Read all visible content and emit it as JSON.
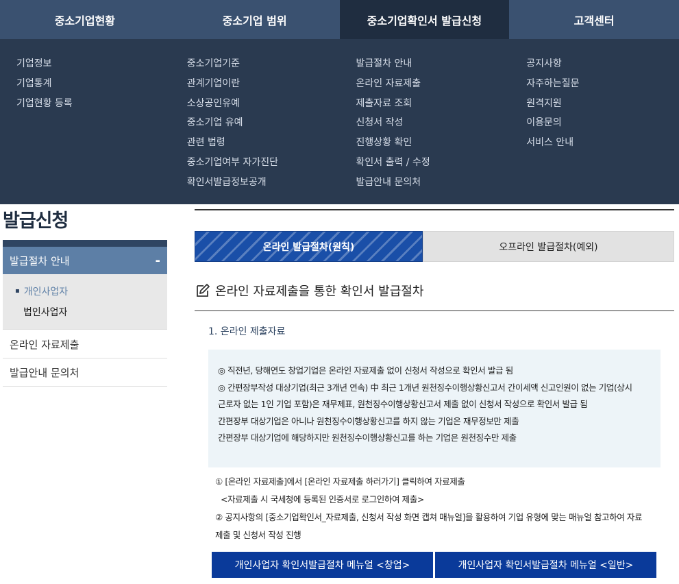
{
  "topnav": {
    "items": [
      {
        "label": "중소기업현황"
      },
      {
        "label": "중소기업 범위"
      },
      {
        "label": "중소기업확인서 발급신청"
      },
      {
        "label": "고객센터"
      }
    ]
  },
  "mega": {
    "col1": [
      "기업정보",
      "기업통계",
      "기업현황 등록"
    ],
    "col2": [
      "중소기업기준",
      "관계기업이란",
      "소상공인유예",
      "중소기업 유예",
      "관련 법령",
      "중소기업여부 자가진단",
      "확인서발급정보공개"
    ],
    "col3": [
      "발급절차 안내",
      "온라인 자료제출",
      "제출자료 조회",
      "신청서 작성",
      "진행상황 확인",
      "확인서 출력 / 수정",
      "발급안내 문의처"
    ],
    "col4": [
      "공지사항",
      "자주하는질문",
      "원격지원",
      "이용문의",
      "서비스 안내"
    ]
  },
  "sidebar": {
    "heading": "발급신청",
    "active_label": "발급절차 안내",
    "collapse_symbol": "-",
    "sub_items": [
      "개인사업자",
      "법인사업자"
    ],
    "items": [
      "온라인 자료제출",
      "발급안내 문의처"
    ]
  },
  "main": {
    "tabs": [
      "온라인 발급절차(원칙)",
      "오프라인 발급절차(예외)"
    ],
    "section_title": "온라인 자료제출을 통한 확인서 발급절차",
    "sub_head": "1. 온라인 제출자료",
    "info_lines": [
      "◎ 직전년, 당해연도 창업기업은 온라인 자료제출 없이 신청서 작성으로 확인서 발급 됨",
      "◎ 간편장부작성 대상기업(최근 3개년 연속) 中 최근 1개년 원천징수이행상황신고서 간이세액 신고인원이 없는 기업(상시",
      "근로자 없는 1인 기업 포함)은 재무제표, 원천징수이행상황신고서 제출 없이 신청서 작성으로 확인서 발급 됨",
      "간편장부 대상기업은 아니나 원천징수이행상황신고를 하지 않는 기업은 재무정보만 제출",
      "간편장부 대상기업에 해당하지만 원천징수이행상황신고를 하는 기업은 원천징수만 제출"
    ],
    "steps": [
      "① [온라인 자료제출]에서 [온라인 자료제출 하러가기] 클릭하여 자료제출",
      "<자료제출 시 국세청에 등록된 인증서로 로그인하여 제출>",
      "② 공지사항의 [중소기업확인서_자료제출, 신청서 작성 화면 캡쳐 매뉴얼]을 활용하여 기업 유형에 맞는 매뉴얼 참고하여 자료",
      "제출 및 신청서 작성 진행"
    ],
    "buttons": [
      "개인사업자 확인서발급절차 메뉴얼 <창업>",
      "개인사업자 확인서발급절차 메뉴얼 <일반>"
    ]
  },
  "colors": {
    "nav_bg": "#3a5170",
    "nav_active": "#1f2d40",
    "mega_bg": "#2a3a50",
    "side_active": "#5d7fa6",
    "tab_active": "#1a4fa8",
    "button": "#0a3a9a",
    "info_bg": "#edf4f8"
  },
  "icons": {
    "section": "edit-icon"
  }
}
